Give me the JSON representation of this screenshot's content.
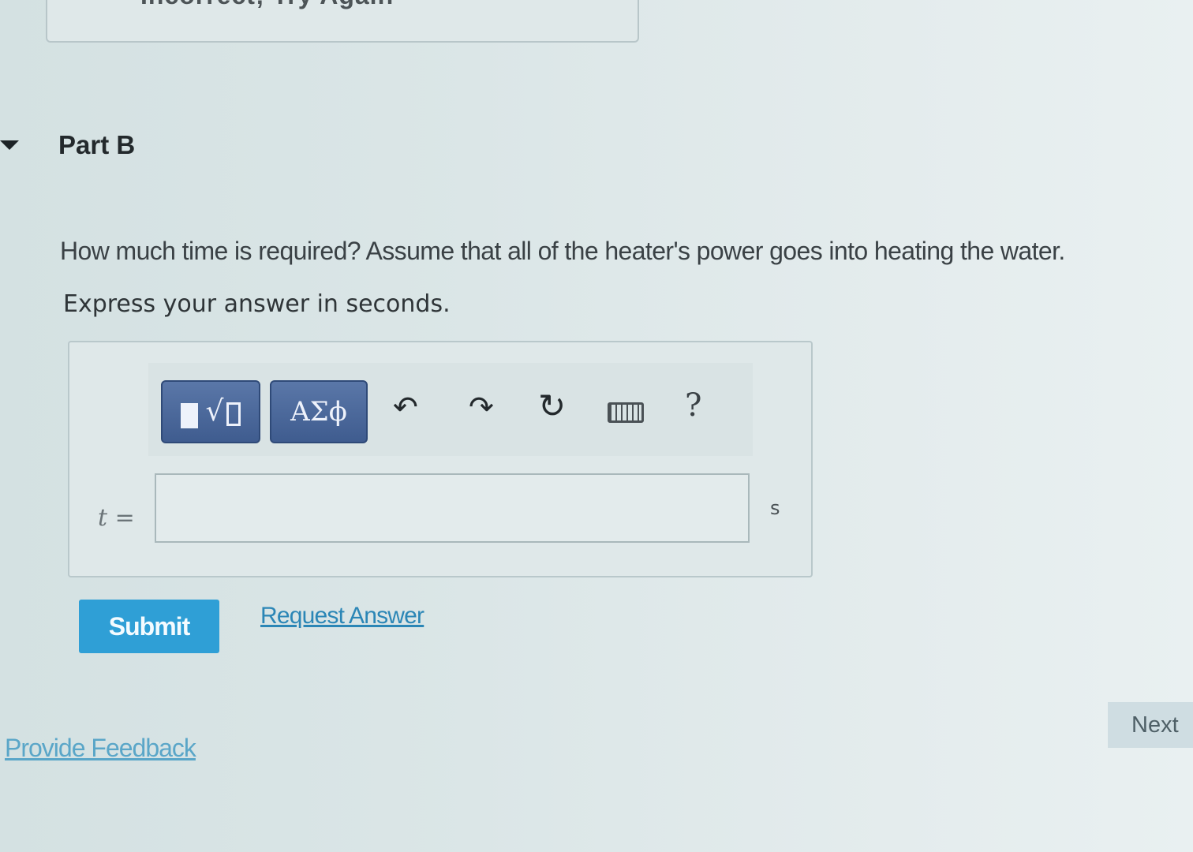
{
  "previous_part": {
    "feedback_text": "Incorrect; Try Again"
  },
  "part": {
    "title": "Part B"
  },
  "question": {
    "text": "How much time is required? Assume that all of the heater's power goes into heating the water.",
    "instruction": "Express your answer in seconds."
  },
  "toolbar": {
    "greek_label": "ΑΣϕ",
    "undo_icon": "↶",
    "redo_icon": "↷",
    "reset_icon": "↻",
    "help_label": "?",
    "icons": [
      "templates-icon",
      "greek-letters-icon",
      "undo-icon",
      "redo-icon",
      "reset-icon",
      "keyboard-icon",
      "help-icon"
    ]
  },
  "answer": {
    "variable": "t",
    "equals": "=",
    "value": "",
    "placeholder": "",
    "unit": "s"
  },
  "actions": {
    "submit_label": "Submit",
    "request_answer_label": "Request Answer"
  },
  "footer": {
    "feedback_label": "Provide Feedback",
    "next_label": "Next"
  },
  "colors": {
    "submit_bg": "#2f9fd6",
    "link": "#2b86b6",
    "toolbar_button": "#3f5c8f"
  }
}
